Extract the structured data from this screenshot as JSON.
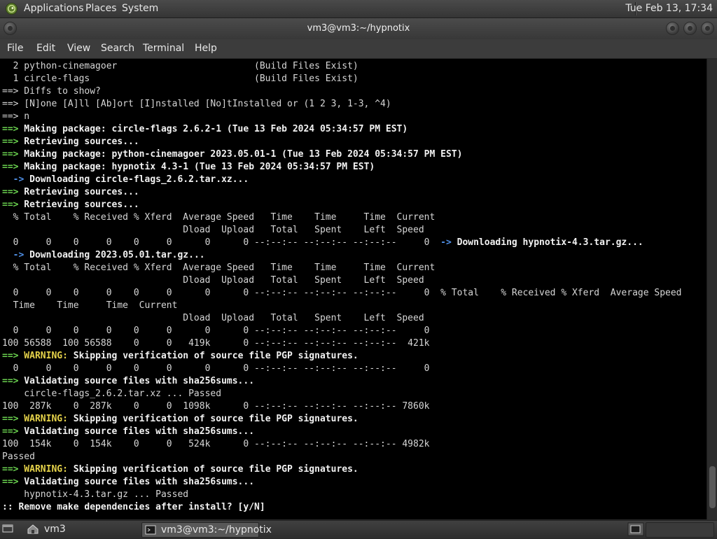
{
  "top_panel": {
    "menus": [
      "Applications",
      "Places",
      "System"
    ],
    "clock": "Tue Feb 13, 17:34"
  },
  "window": {
    "title": "vm3@vm3:~/hypnotix",
    "menu": [
      "File",
      "Edit",
      "View",
      "Search",
      "Terminal",
      "Help"
    ]
  },
  "terminal": {
    "lines": [
      [
        [
          "",
          "  2 python-cinemagoer                         (Build Files Exist)"
        ]
      ],
      [
        [
          "",
          "  1 circle-flags                              (Build Files Exist)"
        ]
      ],
      [
        [
          "",
          "==> Diffs to show?"
        ]
      ],
      [
        [
          "",
          "==> [N]one [A]ll [Ab]ort [I]nstalled [No]tInstalled or (1 2 3, 1-3, ^4)"
        ]
      ],
      [
        [
          "",
          "==> n"
        ]
      ],
      [
        [
          "g",
          "==>"
        ],
        [
          "b",
          " Making package: circle-flags 2.6.2-1 (Tue 13 Feb 2024 05:34:57 PM EST)"
        ]
      ],
      [
        [
          "g",
          "==>"
        ],
        [
          "b",
          " Retrieving sources..."
        ]
      ],
      [
        [
          "g",
          "==>"
        ],
        [
          "b",
          " Making package: python-cinemagoer 2023.05.01-1 (Tue 13 Feb 2024 05:34:57 PM EST)"
        ]
      ],
      [
        [
          "g",
          "==>"
        ],
        [
          "b",
          " Making package: hypnotix 4.3-1 (Tue 13 Feb 2024 05:34:57 PM EST)"
        ]
      ],
      [
        [
          "bl",
          "  ->"
        ],
        [
          "b",
          " Downloading circle-flags_2.6.2.tar.xz..."
        ]
      ],
      [
        [
          "g",
          "==>"
        ],
        [
          "b",
          " Retrieving sources..."
        ]
      ],
      [
        [
          "g",
          "==>"
        ],
        [
          "b",
          " Retrieving sources..."
        ]
      ],
      [
        [
          "",
          "  % Total    % Received % Xferd  Average Speed   Time    Time     Time  Current"
        ]
      ],
      [
        [
          "",
          "                                 Dload  Upload   Total   Spent    Left  Speed"
        ]
      ],
      [
        [
          "",
          "  0     0    0     0    0     0      0      0 --:--:-- --:--:-- --:--:--     0  "
        ],
        [
          "bl",
          "->"
        ],
        [
          "b",
          " Downloading hypnotix-4.3.tar.gz..."
        ]
      ],
      [
        [
          "bl",
          "  ->"
        ],
        [
          "b",
          " Downloading 2023.05.01.tar.gz..."
        ]
      ],
      [
        [
          "",
          "  % Total    % Received % Xferd  Average Speed   Time    Time     Time  Current"
        ]
      ],
      [
        [
          "",
          "                                 Dload  Upload   Total   Spent    Left  Speed"
        ]
      ],
      [
        [
          "",
          "  0     0    0     0    0     0      0      0 --:--:-- --:--:-- --:--:--     0  % Total    % Received % Xferd  Average Speed"
        ]
      ],
      [
        [
          "",
          "  Time    Time     Time  Current"
        ]
      ],
      [
        [
          "",
          "                                 Dload  Upload   Total   Spent    Left  Speed"
        ]
      ],
      [
        [
          "",
          "  0     0    0     0    0     0      0      0 --:--:-- --:--:-- --:--:--     0"
        ]
      ],
      [
        [
          "",
          "100 56588  100 56588    0     0   419k      0 --:--:-- --:--:-- --:--:--  421k"
        ]
      ],
      [
        [
          "g",
          "==>"
        ],
        [
          "y",
          " WARNING:"
        ],
        [
          "b",
          " Skipping verification of source file PGP signatures."
        ]
      ],
      [
        [
          "",
          "  0     0    0     0    0     0      0      0 --:--:-- --:--:-- --:--:--     0"
        ]
      ],
      [
        [
          "g",
          "==>"
        ],
        [
          "b",
          " Validating source files with sha256sums..."
        ]
      ],
      [
        [
          "",
          "    circle-flags_2.6.2.tar.xz ... Passed"
        ]
      ],
      [
        [
          "",
          "100  287k    0  287k    0     0  1098k      0 --:--:-- --:--:-- --:--:-- 7860k"
        ]
      ],
      [
        [
          "g",
          "==>"
        ],
        [
          "y",
          " WARNING:"
        ],
        [
          "b",
          " Skipping verification of source file PGP signatures."
        ]
      ],
      [
        [
          "g",
          "==>"
        ],
        [
          "b",
          " Validating source files with sha256sums..."
        ]
      ],
      [
        [
          "",
          "100  154k    0  154k    0     0   524k      0 --:--:-- --:--:-- --:--:-- 4982k"
        ]
      ],
      [
        [
          "",
          "Passed"
        ]
      ],
      [
        [
          "g",
          "==>"
        ],
        [
          "y",
          " WARNING:"
        ],
        [
          "b",
          " Skipping verification of source file PGP signatures."
        ]
      ],
      [
        [
          "g",
          "==>"
        ],
        [
          "b",
          " Validating source files with sha256sums..."
        ]
      ],
      [
        [
          "",
          "    hypnotix-4.3.tar.gz ... Passed"
        ]
      ],
      [
        [
          "b",
          ":: Remove make dependencies after install? [y/N]"
        ]
      ]
    ]
  },
  "bottom_panel": {
    "workspace_label": "vm3",
    "task_title": "vm3@vm3:~/hypnotix"
  }
}
